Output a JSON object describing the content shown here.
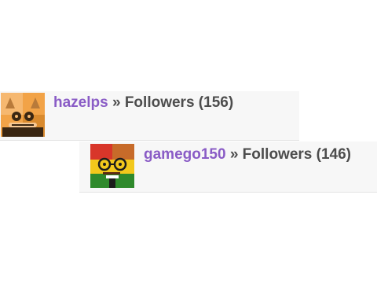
{
  "entries": [
    {
      "username": "hazelps",
      "separator": " » ",
      "label": "Followers",
      "count": "(156)"
    },
    {
      "username": "gamego150",
      "separator": " » ",
      "label": "Followers",
      "count": "(146)"
    }
  ],
  "colors": {
    "link": "#8a5cc6",
    "text": "#4d4d4d",
    "row_bg": "#f7f7f7"
  }
}
